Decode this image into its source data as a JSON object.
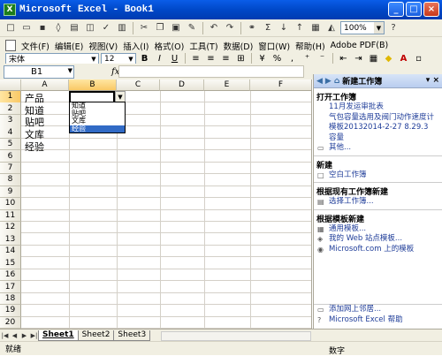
{
  "window": {
    "title": "Microsoft Excel - Book1"
  },
  "toolbar": {
    "zoom": "100%"
  },
  "menu": [
    "文件(F)",
    "编辑(E)",
    "视图(V)",
    "插入(I)",
    "格式(O)",
    "工具(T)",
    "数据(D)",
    "窗口(W)",
    "帮助(H)",
    "Adobe PDF(B)"
  ],
  "format": {
    "font": "宋体",
    "size": "12"
  },
  "formula": {
    "namebox": "B1",
    "fx": "fx",
    "value": ""
  },
  "columns": [
    "A",
    "B",
    "C",
    "D",
    "E",
    "F"
  ],
  "rows": [
    "1",
    "2",
    "3",
    "4",
    "5",
    "6",
    "7",
    "8",
    "9",
    "10",
    "11",
    "12",
    "13",
    "14",
    "15",
    "16",
    "17",
    "18",
    "19",
    "20"
  ],
  "cells_A": [
    "产品",
    "知道",
    "贴吧",
    "文库",
    "经验"
  ],
  "dropdown": {
    "options": [
      "知道",
      "贴吧",
      "文库",
      "经验"
    ],
    "selected_index": 3
  },
  "taskpane": {
    "title": "新建工作簿",
    "open_section": "打开工作簿",
    "recent": [
      "11月发运审批表",
      "气包容量选用及阀门动作速度计",
      "模板20132014-2-27 8.29.3",
      "容量"
    ],
    "more": "其他...",
    "new_section": "新建",
    "blank": "空白工作簿",
    "from_existing_section": "根据现有工作簿新建",
    "choose": "选择工作簿...",
    "from_template_section": "根据模板新建",
    "templates": [
      "通用模板...",
      "我的 Web 站点模板...",
      "Microsoft.com 上的模板"
    ],
    "bottom": [
      "添加网上邻居...",
      "Microsoft Excel 帮助"
    ]
  },
  "sheets": [
    "Sheet1",
    "Sheet2",
    "Sheet3"
  ],
  "status": {
    "ready": "就绪",
    "num": "数字"
  }
}
